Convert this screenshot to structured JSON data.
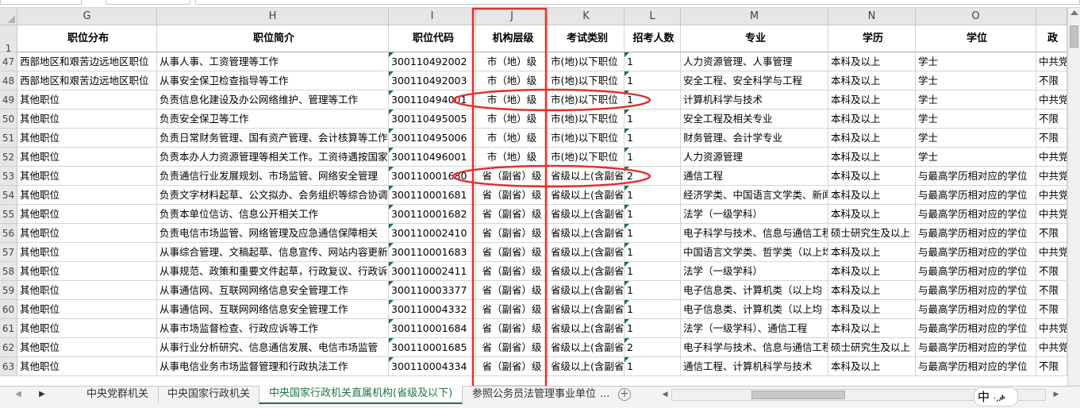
{
  "columns": [
    {
      "letter": "G",
      "header": "职位分布"
    },
    {
      "letter": "H",
      "header": "职位简介"
    },
    {
      "letter": "I",
      "header": "职位代码"
    },
    {
      "letter": "J",
      "header": "机构层级"
    },
    {
      "letter": "K",
      "header": "考试类别"
    },
    {
      "letter": "L",
      "header": "招考人数"
    },
    {
      "letter": "M",
      "header": "专业"
    },
    {
      "letter": "N",
      "header": "学历"
    },
    {
      "letter": "O",
      "header": "学位"
    },
    {
      "letter": "",
      "header": "政"
    }
  ],
  "header_row_number": "1",
  "rows": [
    {
      "num": "47",
      "cells": [
        "西部地区和艰苦边远地区职位",
        "从事人事、工资管理等工作",
        "300110492002",
        "市（地）级",
        "市(地)以下职位",
        "1",
        "人力资源管理、人事管理",
        "本科及以上",
        "学士",
        "中共党员"
      ]
    },
    {
      "num": "48",
      "cells": [
        "西部地区和艰苦边远地区职位",
        "从事安全保卫检查指导等工作",
        "300110492003",
        "市（地）级",
        "市(地)以下职位",
        "1",
        "安全工程、安全科学与工程",
        "本科及以上",
        "学士",
        "不限"
      ]
    },
    {
      "num": "49",
      "cells": [
        "其他职位",
        "负责信息化建设及办公网络维护、管理等工作",
        "300110494001",
        "市（地）级",
        "市(地)以下职位",
        "1",
        "计算机科学与技术",
        "本科及以上",
        "学士",
        "中共党员"
      ]
    },
    {
      "num": "50",
      "cells": [
        "其他职位",
        "负责安全保卫等工作",
        "300110495005",
        "市（地）级",
        "市(地)以下职位",
        "1",
        "安全工程及相关专业",
        "本科及以上",
        "学士",
        "不限"
      ]
    },
    {
      "num": "51",
      "cells": [
        "其他职位",
        "负责日常财务管理、国有资产管理、会计核算等工作",
        "300110495006",
        "市（地）级",
        "市(地)以下职位",
        "1",
        "财务管理、会计学专业",
        "本科及以上",
        "学士",
        "不限"
      ]
    },
    {
      "num": "52",
      "cells": [
        "其他职位",
        "负责本办人力资源管理等相关工作。工资待遇按国家",
        "300110496001",
        "市（地）级",
        "市(地)以下职位",
        "1",
        "人力资源管理",
        "本科及以上",
        "学士",
        "中共党员"
      ]
    },
    {
      "num": "53",
      "cells": [
        "其他职位",
        "负责通信行业发展规划、市场监管、网络安全管理",
        "300110001680",
        "省（副省）级",
        "省级以上(含副省级)",
        "2",
        "通信工程",
        "本科及以上",
        "与最高学历相对应的学位",
        "中共党员"
      ]
    },
    {
      "num": "54",
      "cells": [
        "其他职位",
        "负责文字材料起草、公文拟办、会务组织等综合协调",
        "300110001681",
        "省（副省）级",
        "省级以上(含副省级)",
        "1",
        "经济学类、中国语言文学类、新闻",
        "本科及以上",
        "与最高学历相对应的学位",
        "中共党员"
      ]
    },
    {
      "num": "55",
      "cells": [
        "其他职位",
        "负责本单位信访、信息公开相关工作",
        "300110001682",
        "省（副省）级",
        "省级以上(含副省级)",
        "1",
        "法学（一级学科）",
        "本科及以上",
        "与最高学历相对应的学位",
        "中共党员"
      ]
    },
    {
      "num": "56",
      "cells": [
        "其他职位",
        "负责电信市场监管、网络管理及应急通信保障相关",
        "300110002410",
        "省（副省）级",
        "省级以上(含副省级)",
        "1",
        "电子科学与技术、信息与通信工程",
        "硕士研究生及以上",
        "与最高学历相对应的学位",
        "不限"
      ]
    },
    {
      "num": "57",
      "cells": [
        "其他职位",
        "从事综合管理、文稿起草、信息宣传、网站内容更新",
        "300110001683",
        "省（副省）级",
        "省级以上(含副省级)",
        "1",
        "中国语言文学类、哲学类（以上均",
        "本科及以上",
        "与最高学历相对应的学位",
        "中共党员"
      ]
    },
    {
      "num": "58",
      "cells": [
        "其他职位",
        "从事规范、政策和重要文件起草，行政复议、行政诉",
        "300110002411",
        "省（副省）级",
        "省级以上(含副省级)",
        "1",
        "法学（一级学科）",
        "本科及以上",
        "与最高学历相对应的学位",
        "不限"
      ]
    },
    {
      "num": "59",
      "cells": [
        "其他职位",
        "从事通信网、互联网网络信息安全管理工作",
        "300110003377",
        "省（副省）级",
        "省级以上(含副省级)",
        "1",
        "电子信息类、计算机类（以上均",
        "本科及以上",
        "与最高学历相对应的学位",
        "不限"
      ]
    },
    {
      "num": "60",
      "cells": [
        "其他职位",
        "从事通信网、互联网网络信息安全管理工作",
        "300110004332",
        "省（副省）级",
        "省级以上(含副省级)",
        "1",
        "电子信息类、计算机类（以上均",
        "本科及以上",
        "与最高学历相对应的学位",
        "不限"
      ]
    },
    {
      "num": "61",
      "cells": [
        "其他职位",
        "从事市场监督检查、行政应诉等工作",
        "300110001684",
        "省（副省）级",
        "省级以上(含副省级)",
        "1",
        "法学（一级学科）、通信工程",
        "本科及以上",
        "与最高学历相对应的学位",
        "中共党员"
      ]
    },
    {
      "num": "62",
      "cells": [
        "其他职位",
        "从事行业分析研究、信息通信发展、电信市场监管",
        "300110001685",
        "省（副省）级",
        "省级以上(含副省级)",
        "2",
        "电子科学与技术、信息与通信工程",
        "硕士研究生及以上",
        "与最高学历相对应的学位",
        "中共党员"
      ]
    },
    {
      "num": "63",
      "cells": [
        "其他职位",
        "从事电信业务市场监督管理和行政执法工作",
        "300110004334",
        "省（副省）级",
        "省级以上(含副省级)",
        "1",
        "通信工程、计算机科学与技术",
        "本科及以上",
        "与最高学历相对应的学位",
        "不限"
      ]
    }
  ],
  "sheet_tabs": [
    {
      "label": "中央党群机关",
      "active": false
    },
    {
      "label": "中央国家行政机关",
      "active": false
    },
    {
      "label": "中央国家行政机关直属机构(省级及以下)",
      "active": true
    },
    {
      "label": "参照公务员法管理事业单位",
      "active": false
    }
  ],
  "tab_overflow": "...",
  "add_sheet": "+",
  "ime_indicator": "中",
  "ime_extra": "·,ቃ",
  "colors": {
    "accent": "#217346",
    "annotation": "#e0312f",
    "gridline": "#d4d4d4",
    "header_bg": "#e6e6e6"
  },
  "icons": {
    "nav_left": "left-arrow-icon",
    "nav_right": "right-arrow-icon",
    "add_sheet": "plus-circle-icon"
  }
}
